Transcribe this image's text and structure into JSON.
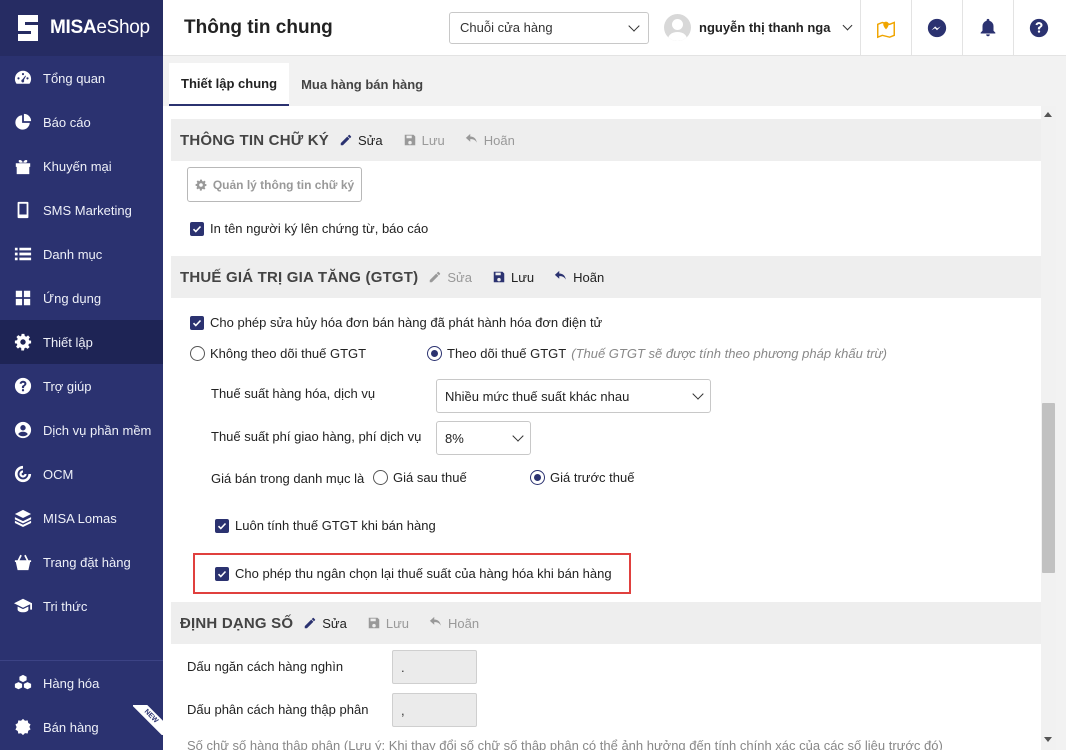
{
  "app": {
    "logo_bold": "MISA",
    "logo_thin": "eShop"
  },
  "sidebar": {
    "items": [
      {
        "label": "Tổng quan",
        "icon": "dashboard-icon"
      },
      {
        "label": "Báo cáo",
        "icon": "pie-chart-icon"
      },
      {
        "label": "Khuyến mại",
        "icon": "gift-icon"
      },
      {
        "label": "SMS Marketing",
        "icon": "mobile-icon"
      },
      {
        "label": "Danh mục",
        "icon": "list-icon"
      },
      {
        "label": "Ứng dụng",
        "icon": "apps-icon"
      },
      {
        "label": "Thiết lập",
        "icon": "gear-icon"
      },
      {
        "label": "Trợ giúp",
        "icon": "help-icon"
      },
      {
        "label": "Dịch vụ phần mềm",
        "icon": "user-circle-icon"
      },
      {
        "label": "OCM",
        "icon": "ocm-icon"
      },
      {
        "label": "MISA Lomas",
        "icon": "layers-icon"
      },
      {
        "label": "Trang đặt hàng",
        "icon": "basket-icon"
      },
      {
        "label": "Tri thức",
        "icon": "graduation-cap-icon"
      }
    ],
    "bottom": [
      {
        "label": "Hàng hóa",
        "icon": "cubes-icon"
      },
      {
        "label": "Bán hàng",
        "icon": "sale-icon",
        "badge": "NEW"
      }
    ]
  },
  "header": {
    "title": "Thông tin chung",
    "store_select": "Chuỗi cửa hàng",
    "user_name": "nguyễn thị thanh nga"
  },
  "tabs": [
    {
      "label": "Thiết lập chung",
      "active": true
    },
    {
      "label": "Mua hàng bán hàng",
      "active": false
    }
  ],
  "signature": {
    "title": "THÔNG TIN CHỮ KÝ",
    "edit": "Sửa",
    "save": "Lưu",
    "cancel": "Hoãn",
    "manage_button": "Quản lý thông tin chữ ký",
    "print_name": "In tên người ký lên chứng từ, báo cáo"
  },
  "vat": {
    "title": "THUẾ GIÁ TRỊ GIA TĂNG (GTGT)",
    "edit": "Sửa",
    "save": "Lưu",
    "cancel": "Hoãn",
    "allow_cancel_invoice": "Cho phép sửa hủy hóa đơn bán hàng đã phát hành hóa đơn điện tử",
    "no_track": "Không theo dõi thuế GTGT",
    "track": "Theo dõi thuế GTGT",
    "track_hint": "(Thuế GTGT sẽ được tính theo phương pháp khấu trừ)",
    "goods_rate_label": "Thuế suất hàng hóa, dịch vụ",
    "goods_rate_value": "Nhiều mức thuế suất khác nhau",
    "delivery_rate_label": "Thuế suất phí giao hàng, phí dịch vụ",
    "delivery_rate_value": "8%",
    "price_label": "Giá bán trong danh mục là",
    "price_after": "Giá sau thuế",
    "price_before": "Giá trước thuế",
    "always_calc": "Luôn tính thuế GTGT khi bán hàng",
    "cashier_choose": "Cho phép thu ngân chọn lại thuế suất của hàng hóa khi bán hàng"
  },
  "number_format": {
    "title": "ĐỊNH DẠNG SỐ",
    "edit": "Sửa",
    "save": "Lưu",
    "cancel": "Hoãn",
    "thousand_label": "Dấu ngăn cách hàng nghìn",
    "thousand_value": ".",
    "decimal_label": "Dấu phân cách hàng thập phân",
    "decimal_value": ",",
    "cut_label": "Số chữ số hàng thập phân (Lưu ý: Khi thay đổi số chữ số thập phân có thể ảnh hưởng đến tính chính xác của các số liệu trước đó)"
  },
  "colors": {
    "sidebar": "#2b3270",
    "accent": "#2b3270",
    "highlight": "#e0403e"
  }
}
